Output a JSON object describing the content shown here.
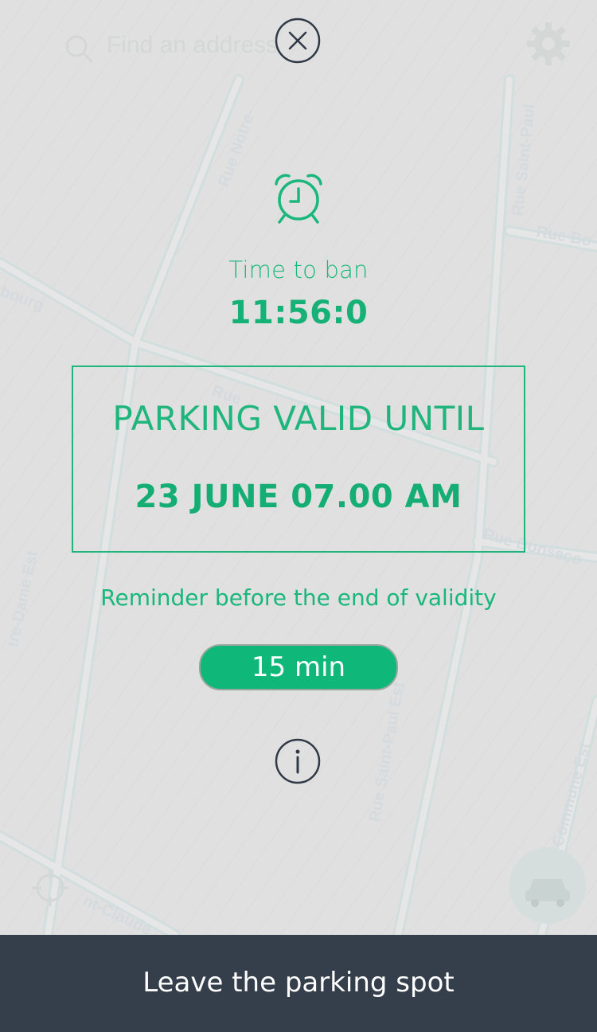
{
  "map": {
    "search_placeholder": "Find an address",
    "search_icon": "search-icon",
    "settings_icon": "gear-icon",
    "locate_icon": "crosshair-icon",
    "car_icon": "car-icon",
    "streets": [
      "Rue Notre-",
      "Rue Saint-Paul",
      "Rue Bo",
      "bourg",
      "Rue",
      "Rue Bonseco",
      "tre-Dame Est",
      "Rue Saint-Paul Est",
      "Commune Est",
      "nt-Claude"
    ]
  },
  "overlay": {
    "close_icon": "close-icon",
    "alarm_icon": "alarm-clock-icon",
    "time_label": "Time to ban",
    "time_value": "11:56:0",
    "valid_title": "PARKING VALID UNTIL",
    "valid_date": "23 JUNE 07.00 AM",
    "reminder_label": "Reminder before the end of validity",
    "reminder_value": "15 min",
    "info_icon": "info-icon"
  },
  "bottom_bar": {
    "label": "Leave the parking spot"
  },
  "colors": {
    "accent": "#19b77c",
    "bottom_bar": "#343f4b",
    "background": "#e0e0e0"
  }
}
